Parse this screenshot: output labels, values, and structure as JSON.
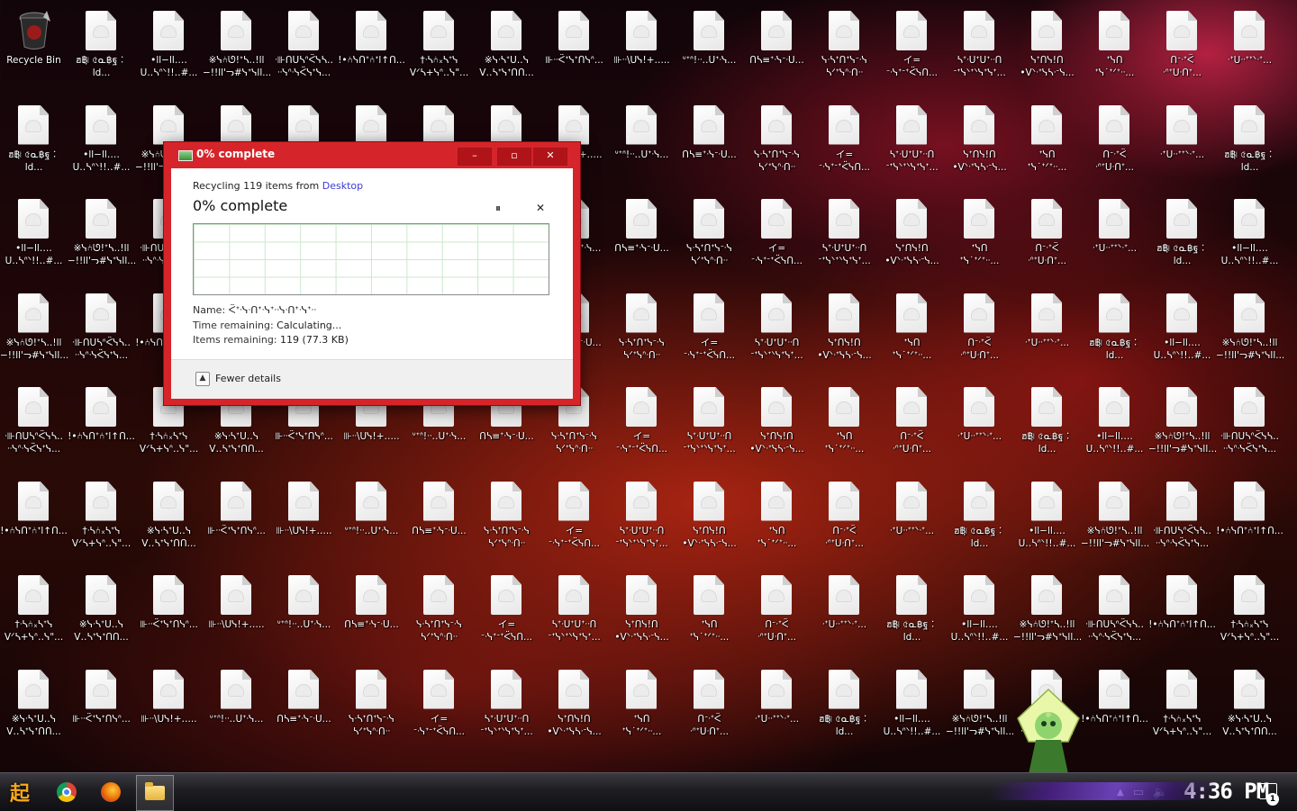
{
  "desktop": {
    "recycle_bin_label": "Recycle Bin",
    "file_labels": [
      "ฮ฿ฺ৷ ৫ᓇ฿ฐ︰ld...",
      "•ll−ll‥‥\nᑌ‥ᓴᐢᐠ!!‥#...",
      "※ᓭ⑃ᘎ!ᐩᓴ‥!ll\n−!!ll'ᓓ#ᓭᐩᓭll...",
      "ᐧ⊪ᑎᑌᓴᐢᑈᓭᓴ‥\nᐧᐧᓭᐢᐧᓭᑈᓭᐩᓭ...",
      "!•⑃ᓭᑎᐩ⑃ᐩl↑ᑎ...",
      "†ᐧᓴ⑃᙮ᓴᐩᓭ\nᐯᐟᓴ+ᓭᐢ‥ᓭ\"...",
      "※ᓭᐧᓴᐩᑌ‥ᓭ\nᐯ‥ᓴᐩᓭᐩᑎᑎ...",
      "⊪ᐧᐧᑈᐩᓭᐩᑎᓭᐢ...",
      "⊪ᐧᐧ\\ᑌᓭ!+‥...",
      "ᐡᐩᐢ!ᐧᐧ‥ᑌᐩᐧᓭ...",
      "ᑎᓴ≡ᐩᐧᓭᐨᐧᑌ...",
      "ᓭᐧᓴᐩᑎᐩᓭᐨᐧᓭ\nᓴᐟᐩᓭᐢᐧᑎᐧᐧ",
      "イ=\nᐨᐧᓭᐩᐨᐩᑈᓭᑎ...",
      "ᓴᐩᐧᑌᐩᑌᐩᐧᐧᑎ\nᐨᐩᓭᐠᐩᐠᓭᐩᓭᐩ...",
      "ᓭᐩᑎᓭ!ᑎ\n•ᐯᐠᐧᐩᓭᓴᐧᐨᓭ...",
      "ᐩᓭᑎ\nᐩᓭ˙ᐩᐟᐩᐧᐧ...",
      "ᑎᐨᐧᐩᑈ\nᐧᐢᐩᑌᐧᑎᐩ...",
      "ᐧᐩᑌᐧᐧᐩᐩᐠᐧᐩ..."
    ],
    "row_labels": [
      "ᐨᐨᑎ\nᐧᐩᐧ'ᓭᐩᐨᐧᐩᐧᐧ...",
      "ᐧᐩᐧᑎᐩᐧᐧᑌᐩ\nᐧᐩᐧᑌᓭᐩ...",
      "ᐧᐧᓴᐩᑌᐩᑎᐧᐩ\nᐧᐩᐧᓴᐩᐧ..."
    ]
  },
  "dialog": {
    "title": "0% complete",
    "minimize": "–",
    "maximize": "▫",
    "close": "✕",
    "recycling_prefix": "Recycling 119 items from ",
    "recycling_source": "Desktop",
    "status": "0% complete",
    "pause_label": "⏸",
    "cancel_label": "✕",
    "name_label": "Name:",
    "name_value": "ᑈᐩᐧᓭᐧᑎᐩᐧᓭᐩᐧᐧᓭᐧᑎᐩᐧᓭᐩᐧᐧ",
    "time_label": "Time remaining:",
    "time_value": "Calculating...",
    "items_label": "Items remaining:",
    "items_value": "119 (77.3 KB)",
    "progress_percent": 0,
    "fewer_details_icon": "chevron-up-icon",
    "fewer_details": "Fewer details"
  },
  "taskbar": {
    "start_label": "起",
    "clock": "4:36 PM",
    "notification_count": "1"
  },
  "colors": {
    "dialog_frame": "#d6252a",
    "accent_link": "#3b3bd6"
  }
}
